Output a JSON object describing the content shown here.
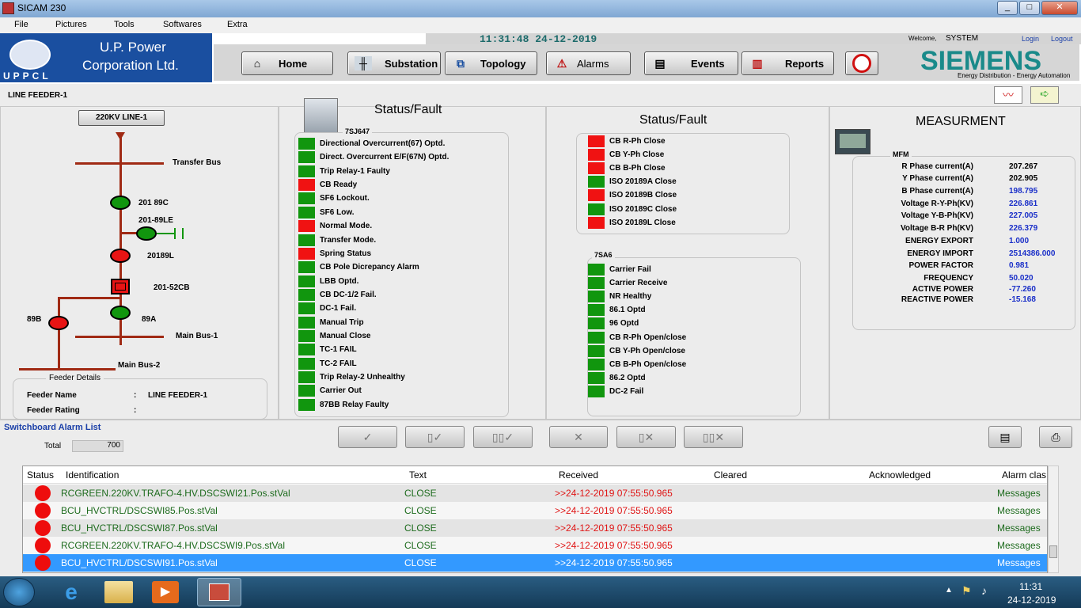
{
  "window": {
    "title": "SICAM 230",
    "controls": [
      "_",
      "□",
      "✕"
    ]
  },
  "menu": [
    "File",
    "Pictures",
    "Tools",
    "Softwares",
    "Extra"
  ],
  "logo": {
    "line1": "U.P. Power",
    "line2": "Corporation Ltd.",
    "abbr": "UPPCL"
  },
  "clock": "11:31:48  24-12-2019",
  "user": {
    "welcome": "Welcome,",
    "name": "SYSTEM",
    "login": "Login",
    "logout": "Logout"
  },
  "nav": {
    "home": "Home",
    "substation": "Substation",
    "topology": "Topology",
    "alarms": "Alarms",
    "events": "Events",
    "reports": "Reports"
  },
  "brand": {
    "name": "SIEMENS",
    "tagline": "Energy Distribution - Energy Automation"
  },
  "page": {
    "title": "LINE FEEDER-1"
  },
  "sld": {
    "line_button": "220KV LINE-1",
    "transfer_bus": "Transfer Bus",
    "main_bus_1": "Main Bus-1",
    "main_bus_2": "Main Bus-2",
    "sw_201_89c": "201 89C",
    "sw_201_89le": "201-89LE",
    "sw_20189l": "20189L",
    "sw_201_52cb": "201-52CB",
    "sw_89a": "89A",
    "sw_89b": "89B",
    "feeder_details": "Feeder Details",
    "feeder_name_label": "Feeder Name",
    "feeder_name_sep": ":",
    "feeder_name": "LINE FEEDER-1",
    "feeder_rating_label": "Feeder Rating",
    "feeder_rating_sep": ":"
  },
  "status1": {
    "title": "Status/Fault",
    "device": "7SJ647",
    "items": [
      {
        "label": "Directional Overcurrent(67) Optd.",
        "color": "g"
      },
      {
        "label": "Direct. Overcurrent E/F(67N) Optd.",
        "color": "g"
      },
      {
        "label": "Trip Relay-1 Faulty",
        "color": "g"
      },
      {
        "label": "CB Ready",
        "color": "r"
      },
      {
        "label": "SF6 Lockout.",
        "color": "g"
      },
      {
        "label": "SF6 Low.",
        "color": "g"
      },
      {
        "label": "Normal Mode.",
        "color": "r"
      },
      {
        "label": "Transfer Mode.",
        "color": "g"
      },
      {
        "label": "Spring Status",
        "color": "r"
      },
      {
        "label": "CB Pole Dicrepancy Alarm",
        "color": "g"
      },
      {
        "label": "LBB Optd.",
        "color": "g"
      },
      {
        "label": "CB DC-1/2 Fail.",
        "color": "g"
      },
      {
        "label": "DC-1 Fail.",
        "color": "g"
      },
      {
        "label": "Manual Trip",
        "color": "g"
      },
      {
        "label": "Manual Close",
        "color": "g"
      },
      {
        "label": "TC-1 FAIL",
        "color": "g"
      },
      {
        "label": "TC-2 FAIL",
        "color": "g"
      },
      {
        "label": "Trip Relay-2 Unhealthy",
        "color": "g"
      },
      {
        "label": "Carrier Out",
        "color": "g"
      },
      {
        "label": "87BB Relay Faulty",
        "color": "g"
      }
    ]
  },
  "status2": {
    "title": "Status/Fault",
    "items": [
      {
        "label": "CB R-Ph Close",
        "color": "r"
      },
      {
        "label": "CB Y-Ph Close",
        "color": "r"
      },
      {
        "label": "CB B-Ph Close",
        "color": "r"
      },
      {
        "label": "ISO 20189A Close",
        "color": "g"
      },
      {
        "label": "ISO 20189B Close",
        "color": "r"
      },
      {
        "label": "ISO 20189C Close",
        "color": "g"
      },
      {
        "label": "ISO 20189L Close",
        "color": "r"
      }
    ],
    "device2": "7SA6",
    "items2": [
      {
        "label": "Carrier Fail",
        "color": "g"
      },
      {
        "label": "Carrier Receive",
        "color": "g"
      },
      {
        "label": "NR Healthy",
        "color": "g"
      },
      {
        "label": "86.1 Optd",
        "color": "g"
      },
      {
        "label": "96 Optd",
        "color": "g"
      },
      {
        "label": "CB R-Ph Open/close",
        "color": "g"
      },
      {
        "label": "CB Y-Ph Open/close",
        "color": "g"
      },
      {
        "label": "CB B-Ph Open/close",
        "color": "g"
      },
      {
        "label": "86.2 Optd",
        "color": "g"
      },
      {
        "label": "DC-2 Fail",
        "color": "g"
      }
    ]
  },
  "measure": {
    "title": "MEASURMENT",
    "group": "MFM",
    "items": [
      {
        "label": "R Phase current(A)",
        "value": "207.267",
        "blue": false
      },
      {
        "label": "Y Phase current(A)",
        "value": "202.905",
        "blue": false
      },
      {
        "label": "B Phase current(A)",
        "value": "198.795",
        "blue": true
      },
      {
        "label": "Voltage R-Y-Ph(KV)",
        "value": "226.861",
        "blue": true
      },
      {
        "label": "Voltage Y-B-Ph(KV)",
        "value": "227.005",
        "blue": true
      },
      {
        "label": "Voltage B-R Ph(KV)",
        "value": "226.379",
        "blue": true
      },
      {
        "label": "ENERGY EXPORT",
        "value": "1.000",
        "blue": true
      },
      {
        "label": "ENERGY IMPORT",
        "value": "2514386.000",
        "blue": true
      },
      {
        "label": "POWER FACTOR",
        "value": "0.981",
        "blue": true
      },
      {
        "label": "FREQUENCY",
        "value": "50.020",
        "blue": true
      },
      {
        "label": "ACTIVE POWER",
        "value": "-77.260",
        "blue": true
      },
      {
        "label": "REACTIVE POWER",
        "value": "-15.168",
        "blue": true
      }
    ]
  },
  "alarmlist": {
    "title": "Switchboard Alarm List",
    "total_label": "Total",
    "total": "700",
    "columns": [
      "Status",
      "Identification",
      "Text",
      "Received",
      "Cleared",
      "Acknowledged",
      "Alarm clas"
    ],
    "rows": [
      {
        "id": "RCGREEN.220KV.TRAFO-4.HV.DSCSWI21.Pos.stVal",
        "text": "CLOSE",
        "received": ">>24-12-2019 07:55:50.965",
        "cleared": "",
        "ack": "",
        "cls": "Messages"
      },
      {
        "id": "BCU_HVCTRL/DSCSWI85.Pos.stVal",
        "text": "CLOSE",
        "received": ">>24-12-2019 07:55:50.965",
        "cleared": "",
        "ack": "",
        "cls": "Messages"
      },
      {
        "id": "BCU_HVCTRL/DSCSWI87.Pos.stVal",
        "text": "CLOSE",
        "received": ">>24-12-2019 07:55:50.965",
        "cleared": "",
        "ack": "",
        "cls": "Messages"
      },
      {
        "id": "RCGREEN.220KV.TRAFO-4.HV.DSCSWI9.Pos.stVal",
        "text": "CLOSE",
        "received": ">>24-12-2019 07:55:50.965",
        "cleared": "",
        "ack": "",
        "cls": "Messages"
      },
      {
        "id": "BCU_HVCTRL/DSCSWI91.Pos.stVal",
        "text": "CLOSE",
        "received": ">>24-12-2019 07:55:50.965",
        "cleared": "",
        "ack": "",
        "cls": "Messages"
      }
    ]
  },
  "taskbar": {
    "time": "11:31",
    "date": "24-12-2019"
  },
  "colors": {
    "led_green": "#11960e",
    "led_red": "#f01212",
    "siemens": "#1a8a8a",
    "row_green": "#1d6b1d",
    "row_red": "#e01616",
    "selected": "#3399ff"
  }
}
